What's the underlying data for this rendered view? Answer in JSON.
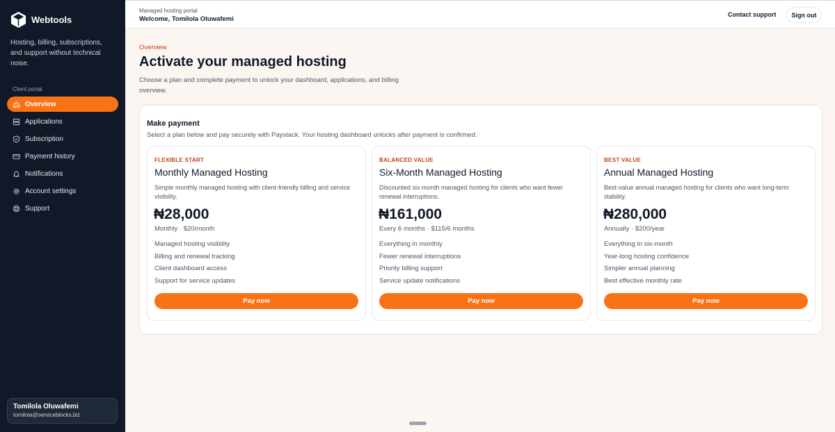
{
  "brand": {
    "name": "Webtools",
    "icon": "cube-icon"
  },
  "sidebar": {
    "tagline": "Hosting, billing, subscriptions, and support without technical noise.",
    "section_label": "Client portal",
    "items": [
      {
        "label": "Overview",
        "icon": "home-icon",
        "active": true
      },
      {
        "label": "Applications",
        "icon": "server-icon"
      },
      {
        "label": "Subscription",
        "icon": "shield-icon"
      },
      {
        "label": "Payment history",
        "icon": "credit-card-icon"
      },
      {
        "label": "Notifications",
        "icon": "bell-icon"
      },
      {
        "label": "Account settings",
        "icon": "gear-icon"
      },
      {
        "label": "Support",
        "icon": "lifebuoy-icon"
      }
    ],
    "user": {
      "name": "Tomilola Oluwafemi",
      "email": "tomilola@serviceblocks.biz"
    }
  },
  "header": {
    "portal_label": "Managed hosting portal",
    "welcome": "Welcome, Tomilola Oluwafemi",
    "contact_label": "Contact support",
    "signout_label": "Sign out"
  },
  "main": {
    "eyebrow": "Overview",
    "title": "Activate your managed hosting",
    "description": "Choose a plan and complete payment to unlock your dashboard, applications, and billing overview."
  },
  "payment": {
    "title": "Make payment",
    "description": "Select a plan below and pay securely with Paystack. Your hosting dashboard unlocks after payment is confirmed.",
    "plans": [
      {
        "tag": "FLEXIBLE START",
        "name": "Monthly Managed Hosting",
        "description": "Simple monthly managed hosting with client-friendly billing and service visibility.",
        "price": "₦28,000",
        "period": "Monthly · $20/month",
        "features": [
          "Managed hosting visibility",
          "Billing and renewal tracking",
          "Client dashboard access",
          "Support for service updates"
        ],
        "button": "Pay now"
      },
      {
        "tag": "BALANCED VALUE",
        "name": "Six-Month Managed Hosting",
        "description": "Discounted six-month managed hosting for clients who want fewer renewal interruptions.",
        "price": "₦161,000",
        "period": "Every 6 months · $115/6 months",
        "features": [
          "Everything in monthly",
          "Fewer renewal interruptions",
          "Priority billing support",
          "Service update notifications"
        ],
        "button": "Pay now"
      },
      {
        "tag": "BEST VALUE",
        "name": "Annual Managed Hosting",
        "description": "Best-value annual managed hosting for clients who want long-term stability.",
        "price": "₦280,000",
        "period": "Annually · $200/year",
        "features": [
          "Everything in six-month",
          "Year-long hosting confidence",
          "Simpler annual planning",
          "Best effective monthly rate"
        ],
        "button": "Pay now"
      }
    ]
  },
  "colors": {
    "accent": "#f97316",
    "accent_text": "#c2410c",
    "sidebar_bg": "#111827",
    "page_bg": "#fbf6f1"
  }
}
